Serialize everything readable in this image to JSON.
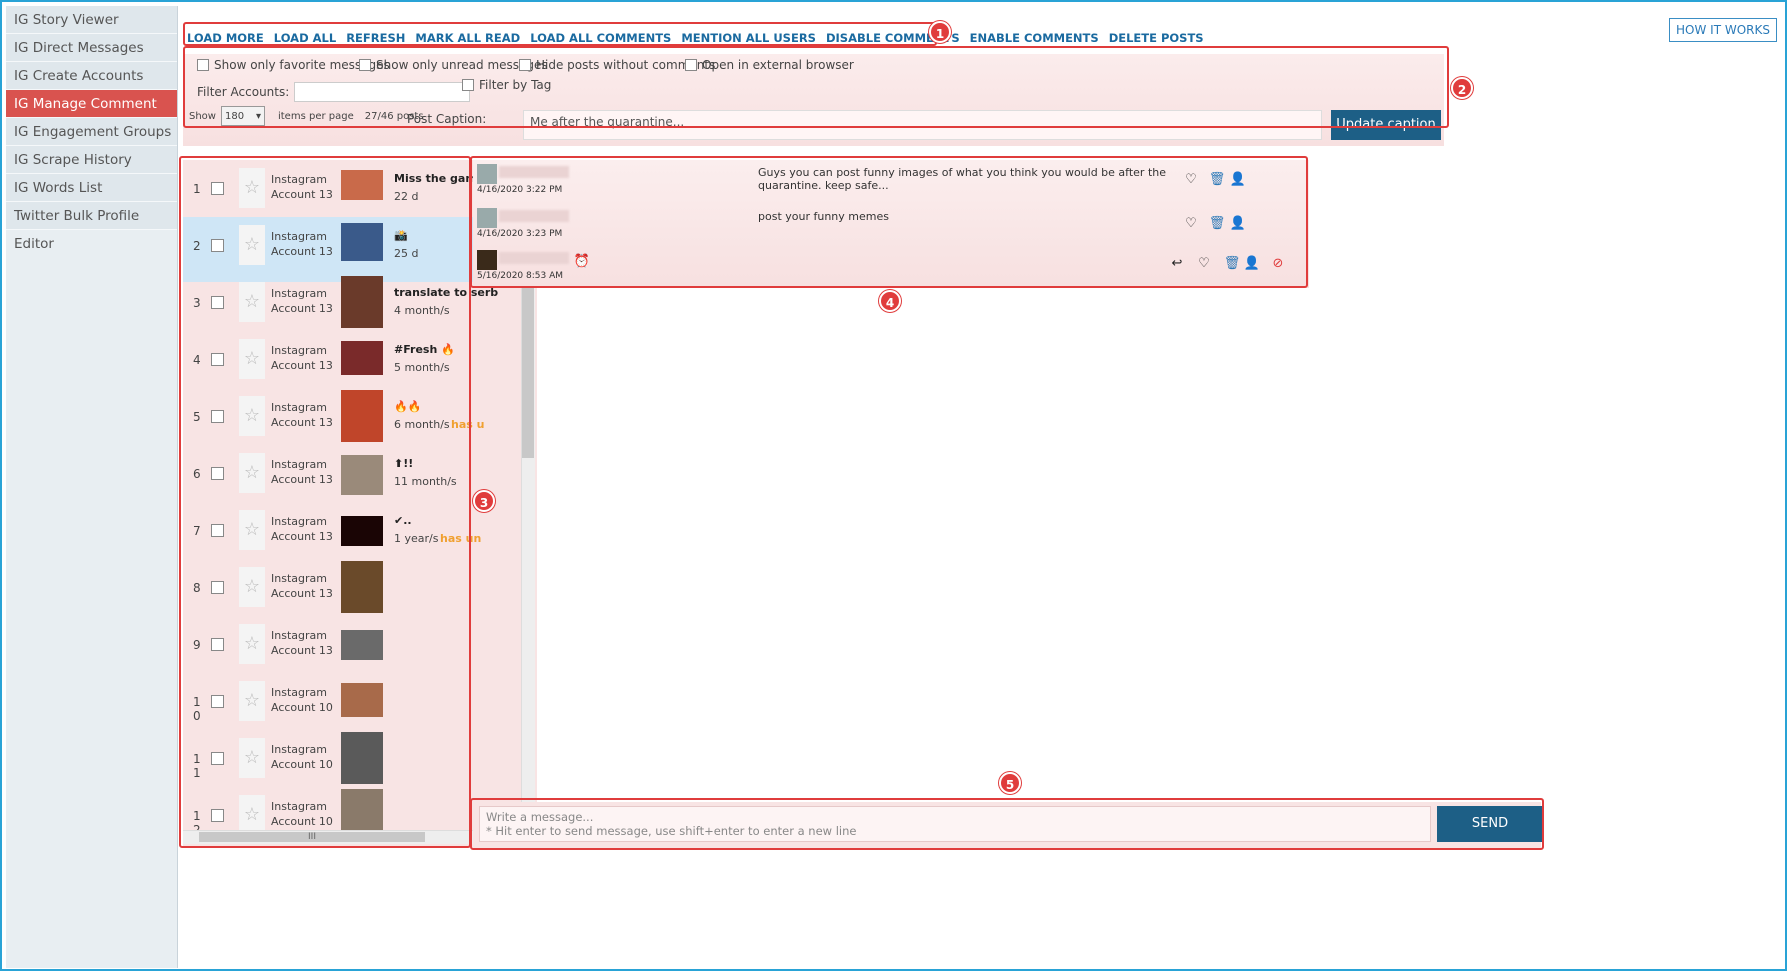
{
  "sidebar": {
    "items": [
      {
        "label": "IG Story Viewer"
      },
      {
        "label": "IG Direct Messages"
      },
      {
        "label": "IG Create Accounts"
      },
      {
        "label": "IG Manage Comment"
      },
      {
        "label": "IG Engagement Groups"
      },
      {
        "label": "IG Scrape History"
      },
      {
        "label": "IG Words List"
      },
      {
        "label": "Twitter Bulk Profile Editor"
      }
    ],
    "active_index": 3
  },
  "toolbar": {
    "links": [
      "LOAD MORE",
      "LOAD ALL",
      "REFRESH",
      "MARK ALL READ",
      "LOAD ALL COMMENTS",
      "MENTION ALL USERS",
      "DISABLE COMMENTS",
      "ENABLE COMMENTS",
      "DELETE POSTS"
    ],
    "how_it_works": "HOW IT WORKS"
  },
  "badges": [
    "1",
    "2",
    "3",
    "4",
    "5"
  ],
  "filters": {
    "fav_only": "Show only favorite messages",
    "unread_only": "Show only unread messages",
    "hide_no_comments": "Hide posts without comments",
    "external_browser": "Open in external browser",
    "filter_accounts_label": "Filter Accounts:",
    "filter_by_tag": "Filter by Tag",
    "show_label": "Show",
    "show_value": "180",
    "items_per_page": "items per page",
    "post_count": "27/46 posts",
    "post_caption_label": "Post Caption:",
    "post_caption_value": "Me after the quarantine...",
    "update_caption": "Update caption"
  },
  "posts": [
    {
      "num": "1",
      "account": "Instagram Account 13",
      "title": "Miss the game!",
      "age": "22 d",
      "unread": "",
      "thumb_color": "#c96a4a"
    },
    {
      "num": "2",
      "account": "Instagram Account 13",
      "title": "📸",
      "age": "25 d",
      "unread": "",
      "thumb_color": "#3a5a8a",
      "selected": true
    },
    {
      "num": "3",
      "account": "Instagram Account 13",
      "title": "translate to serb",
      "age": "4 month/s",
      "unread": "",
      "thumb_color": "#6a3a2a"
    },
    {
      "num": "4",
      "account": "Instagram Account 13",
      "title": "#Fresh 🔥",
      "age": "5 month/s",
      "unread": "",
      "thumb_color": "#7a2a2a"
    },
    {
      "num": "5",
      "account": "Instagram Account 13",
      "title": "🔥🔥",
      "age": "6 month/s",
      "unread": "has u",
      "thumb_color": "#c0452a"
    },
    {
      "num": "6",
      "account": "Instagram Account 13",
      "title": "⬆!!",
      "age": "11 month/s",
      "unread": "",
      "thumb_color": "#9a8a7a"
    },
    {
      "num": "7",
      "account": "Instagram Account 13",
      "title": "✔..",
      "age": "1 year/s",
      "unread": "has un",
      "thumb_color": "#1a0505"
    },
    {
      "num": "8",
      "account": "Instagram Account 13",
      "title": "",
      "age": "",
      "unread": "",
      "thumb_color": "#6a4a2a"
    },
    {
      "num": "9",
      "account": "Instagram Account 13",
      "title": "",
      "age": "",
      "unread": "",
      "thumb_color": "#6a6a6a"
    },
    {
      "num": "10",
      "account": "Instagram Account 10",
      "title": "",
      "age": "",
      "unread": "",
      "thumb_color": "#a86a4a"
    },
    {
      "num": "11",
      "account": "Instagram Account 10",
      "title": "",
      "age": "",
      "unread": "",
      "thumb_color": "#5a5a5a"
    },
    {
      "num": "12",
      "account": "Instagram Account 10",
      "title": "",
      "age": "",
      "unread": "",
      "thumb_color": "#8a7a6a"
    }
  ],
  "comments": [
    {
      "date": "4/16/2020 3:22 PM",
      "text": "Guys you can post funny images of what you think you would be after the quarantine. keep safe...",
      "avatar_color": "#9aa"
    },
    {
      "date": "4/16/2020 3:23 PM",
      "text": "post your funny memes",
      "avatar_color": "#9aa"
    },
    {
      "date": "5/16/2020 8:53 AM",
      "text": "",
      "avatar_color": "#3a2a1a"
    }
  ],
  "message": {
    "placeholder_line1": "Write a message...",
    "placeholder_line2": "* Hit enter to send message, use shift+enter to enter a new line",
    "send_label": "SEND COMMENT"
  },
  "scroll_grip": "III",
  "colors": {
    "accent_red": "#e03c3c",
    "primary": "#1d5f86",
    "link": "#1a6aa0",
    "unread": "#f0a030"
  }
}
